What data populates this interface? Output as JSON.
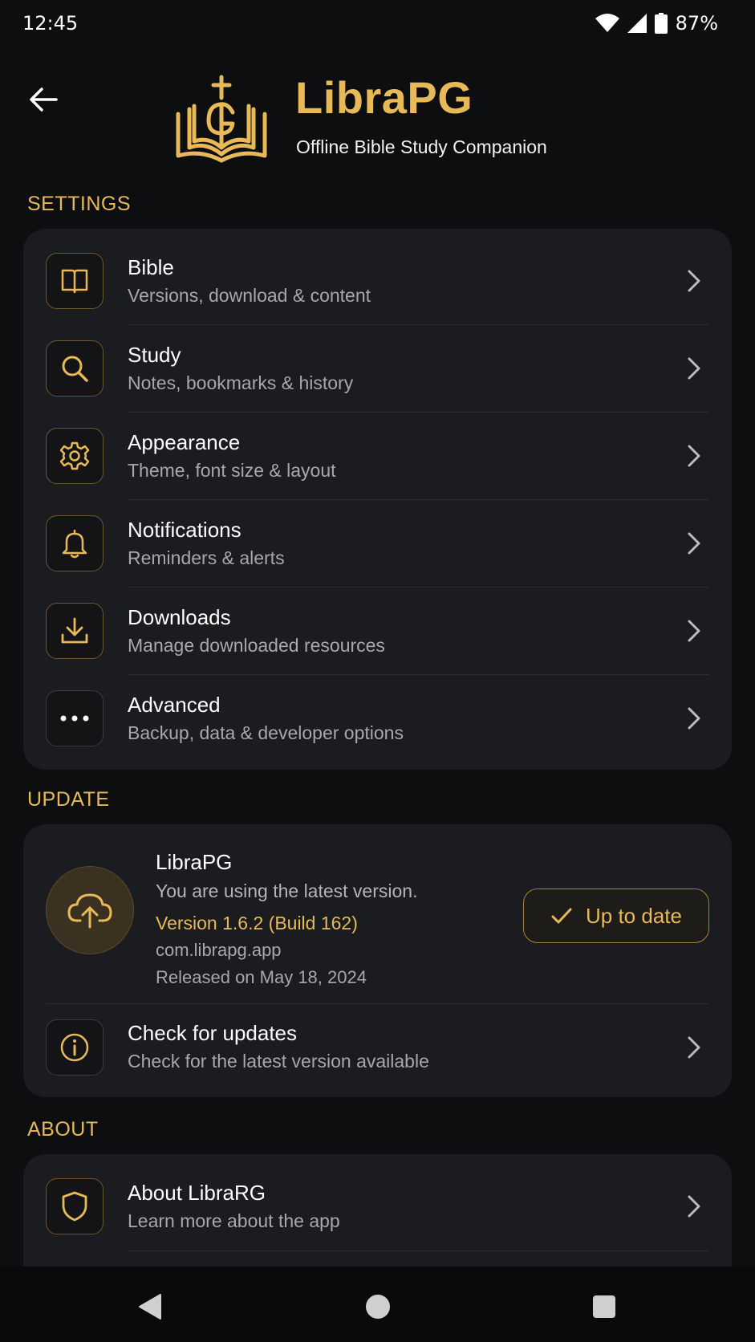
{
  "status_bar": {
    "time": "12:45",
    "battery": "87%"
  },
  "header": {
    "title": "LibraPG",
    "subtitle": "Offline Bible Study Companion"
  },
  "settings": {
    "label": "SETTINGS",
    "items": [
      {
        "title": "Bible",
        "subtitle": "Versions, download & content",
        "icon": "book-icon"
      },
      {
        "title": "Study",
        "subtitle": "Notes, bookmarks & history",
        "icon": "search-icon"
      },
      {
        "title": "Appearance",
        "subtitle": "Theme, font size & layout",
        "icon": "gear-icon"
      },
      {
        "title": "Notifications",
        "subtitle": "Reminders & alerts",
        "icon": "bell-icon"
      },
      {
        "title": "Downloads",
        "subtitle": "Manage downloaded resources",
        "icon": "download-icon"
      },
      {
        "title": "Advanced",
        "subtitle": "Backup, data & developer options",
        "icon": "more-icon"
      }
    ]
  },
  "update": {
    "label": "UPDATE",
    "app_name": "LibraPG",
    "status_text": "You are using the latest version.",
    "version": "Version 1.6.2",
    "build": "(Build 162)",
    "package": "com.librapg.app",
    "released": "Released on May 18, 2024",
    "button_label": "Up to date",
    "check": {
      "title": "Check for updates",
      "subtitle": "Check for the latest version available"
    }
  },
  "about": {
    "label": "ABOUT",
    "items": [
      {
        "title": "About LibraRG",
        "subtitle": "Learn more about the app",
        "icon": "shield-icon"
      }
    ]
  },
  "colors": {
    "accent": "#e8b957",
    "background": "#0d0e10",
    "card": "#1b1c1f"
  }
}
